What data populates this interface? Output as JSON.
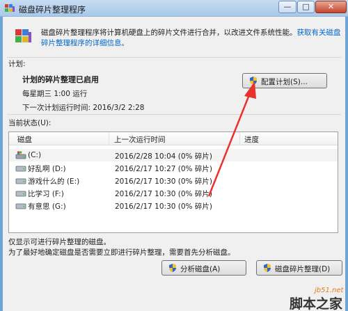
{
  "window": {
    "title": "磁盘碎片整理程序",
    "buttons": {
      "minimize": "—",
      "maximize": "□",
      "close": "✕"
    }
  },
  "intro": {
    "text": "磁盘碎片整理程序将计算机硬盘上的碎片文件进行合并，以改进文件系统性能。",
    "link": "获取有关磁盘碎片整理程序的详细信息。"
  },
  "schedule": {
    "section_label": "计划:",
    "title": "计划的碎片整理已启用",
    "run_time": "每星期三 1:00 运行",
    "next_run": "下一次计划运行时间: 2016/3/2 2:28",
    "config_button": "配置计划(S)..."
  },
  "status": {
    "section_label": "当前状态(U):",
    "columns": [
      "磁盘",
      "上一次运行时间",
      "进度"
    ],
    "rows": [
      {
        "disk": "(C:)",
        "last_run": "2016/2/28 10:04 (0% 碎片)",
        "progress": ""
      },
      {
        "disk": "好乱啊 (D:)",
        "last_run": "2016/2/17 10:27 (0% 碎片)",
        "progress": ""
      },
      {
        "disk": "游戏什么的 (E:)",
        "last_run": "2016/2/17 10:30 (0% 碎片)",
        "progress": ""
      },
      {
        "disk": "比学习 (F:)",
        "last_run": "2016/2/17 10:30 (0% 碎片)",
        "progress": ""
      },
      {
        "disk": "有意思 (G:)",
        "last_run": "2016/2/17 10:30 (0% 碎片)",
        "progress": ""
      }
    ]
  },
  "notes": {
    "line1": "仅显示可进行碎片整理的磁盘。",
    "line2": "为了最好地确定磁盘是否需要立即进行碎片整理，需要首先分析磁盘。"
  },
  "actions": {
    "analyze": "分析磁盘(A)",
    "defrag": "磁盘碎片整理(D)"
  },
  "watermark": {
    "site": "jb51.net",
    "brand": "脚本之家"
  },
  "colors": {
    "accent": "#0066cc",
    "arrow": "#e8322a",
    "shield_blue": "#2f66c8",
    "shield_yellow": "#f2c12e"
  }
}
